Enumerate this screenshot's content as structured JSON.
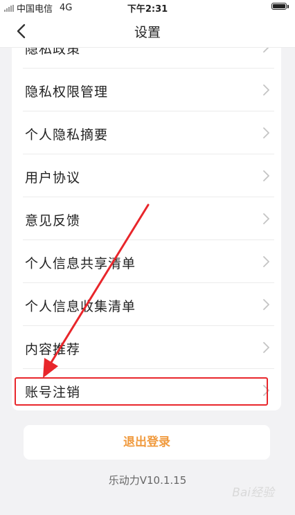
{
  "status_bar": {
    "carrier": "中国电信",
    "network": "4G",
    "time": "下午2:31"
  },
  "nav": {
    "title": "设置",
    "back_icon": "chevron-left-icon"
  },
  "settings_items": [
    {
      "label": "隐私政策"
    },
    {
      "label": "隐私权限管理"
    },
    {
      "label": "个人隐私摘要"
    },
    {
      "label": "用户协议"
    },
    {
      "label": "意见反馈"
    },
    {
      "label": "个人信息共享清单"
    },
    {
      "label": "个人信息收集清单"
    },
    {
      "label": "内容推荐"
    },
    {
      "label": "账号注销"
    }
  ],
  "logout": {
    "label": "退出登录"
  },
  "version": "乐动力V10.1.15",
  "watermark": "Bai经验",
  "colors": {
    "accent": "#f09a3e",
    "annotation": "#e8262b",
    "background": "#f2f2f4"
  }
}
